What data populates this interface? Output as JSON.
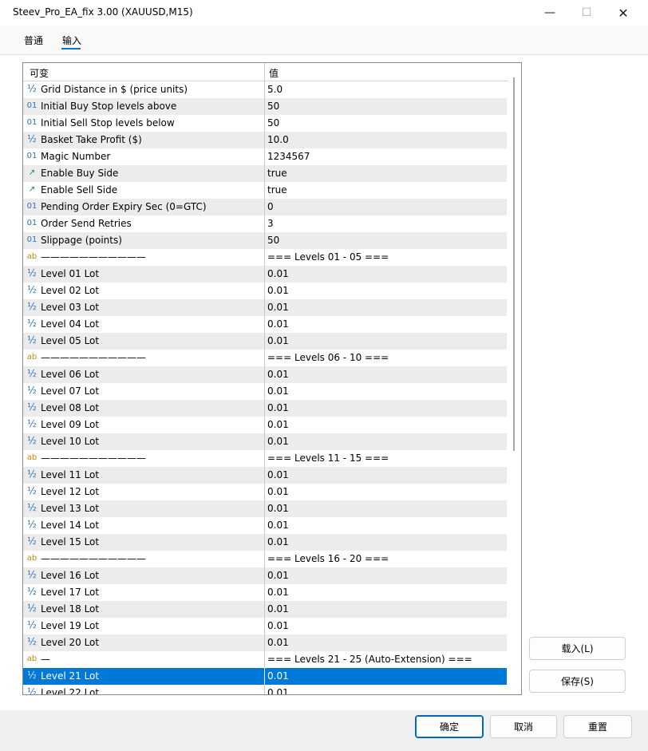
{
  "window": {
    "title": "Steev_Pro_EA_fix 3.00 (XAUUSD,M15)",
    "minimize_glyph": "—",
    "maximize_glyph": "☐",
    "close_glyph": "✕"
  },
  "tabs": [
    {
      "label": "普通"
    },
    {
      "label": "输入"
    }
  ],
  "table": {
    "col_variable": "可变",
    "col_value": "值",
    "rows": [
      {
        "icon": "½",
        "type": "double",
        "name": "Grid Distance in $ (price units)",
        "value": "5.0"
      },
      {
        "icon": "01",
        "type": "int",
        "name": "Initial Buy Stop levels above",
        "value": "50"
      },
      {
        "icon": "01",
        "type": "int",
        "name": "Initial Sell Stop levels below",
        "value": "50"
      },
      {
        "icon": "½",
        "type": "double",
        "name": "Basket Take Profit ($)",
        "value": "10.0"
      },
      {
        "icon": "01",
        "type": "int",
        "name": "Magic Number",
        "value": "1234567"
      },
      {
        "icon": "↗",
        "type": "bool",
        "name": "Enable Buy Side",
        "value": "true"
      },
      {
        "icon": "↗",
        "type": "bool",
        "name": "Enable Sell Side",
        "value": "true"
      },
      {
        "icon": "01",
        "type": "int",
        "name": "Pending Order Expiry Sec (0=GTC)",
        "value": "0"
      },
      {
        "icon": "01",
        "type": "int",
        "name": "Order Send Retries",
        "value": "3"
      },
      {
        "icon": "01",
        "type": "int",
        "name": "Slippage (points)",
        "value": "50"
      },
      {
        "icon": "ab",
        "type": "string",
        "name": "———————————",
        "value": "=== Levels 01 - 05 ==="
      },
      {
        "icon": "½",
        "type": "double",
        "name": "Level 01 Lot",
        "value": "0.01"
      },
      {
        "icon": "½",
        "type": "double",
        "name": "Level 02 Lot",
        "value": "0.01"
      },
      {
        "icon": "½",
        "type": "double",
        "name": "Level 03 Lot",
        "value": "0.01"
      },
      {
        "icon": "½",
        "type": "double",
        "name": "Level 04 Lot",
        "value": "0.01"
      },
      {
        "icon": "½",
        "type": "double",
        "name": "Level 05 Lot",
        "value": "0.01"
      },
      {
        "icon": "ab",
        "type": "string",
        "name": "———————————",
        "value": "=== Levels 06 - 10 ==="
      },
      {
        "icon": "½",
        "type": "double",
        "name": "Level 06 Lot",
        "value": "0.01"
      },
      {
        "icon": "½",
        "type": "double",
        "name": "Level 07 Lot",
        "value": "0.01"
      },
      {
        "icon": "½",
        "type": "double",
        "name": "Level 08 Lot",
        "value": "0.01"
      },
      {
        "icon": "½",
        "type": "double",
        "name": "Level 09 Lot",
        "value": "0.01"
      },
      {
        "icon": "½",
        "type": "double",
        "name": "Level 10 Lot",
        "value": "0.01"
      },
      {
        "icon": "ab",
        "type": "string",
        "name": "———————————",
        "value": "=== Levels 11 - 15 ==="
      },
      {
        "icon": "½",
        "type": "double",
        "name": "Level 11 Lot",
        "value": "0.01"
      },
      {
        "icon": "½",
        "type": "double",
        "name": "Level 12 Lot",
        "value": "0.01"
      },
      {
        "icon": "½",
        "type": "double",
        "name": "Level 13 Lot",
        "value": "0.01"
      },
      {
        "icon": "½",
        "type": "double",
        "name": "Level 14 Lot",
        "value": "0.01"
      },
      {
        "icon": "½",
        "type": "double",
        "name": "Level 15 Lot",
        "value": "0.01"
      },
      {
        "icon": "ab",
        "type": "string",
        "name": "———————————",
        "value": "=== Levels 16 - 20 ==="
      },
      {
        "icon": "½",
        "type": "double",
        "name": "Level 16 Lot",
        "value": "0.01"
      },
      {
        "icon": "½",
        "type": "double",
        "name": "Level 17 Lot",
        "value": "0.01"
      },
      {
        "icon": "½",
        "type": "double",
        "name": "Level 18 Lot",
        "value": "0.01"
      },
      {
        "icon": "½",
        "type": "double",
        "name": "Level 19 Lot",
        "value": "0.01"
      },
      {
        "icon": "½",
        "type": "double",
        "name": "Level 20 Lot",
        "value": "0.01"
      },
      {
        "icon": "ab",
        "type": "string",
        "name": "—",
        "value": "=== Levels 21 - 25 (Auto-Extension) ==="
      },
      {
        "icon": "½",
        "type": "double",
        "name": "Level 21 Lot",
        "value": "0.01",
        "selected": true
      },
      {
        "icon": "½",
        "type": "double",
        "name": "Level 22 Lot",
        "value": "0.01"
      }
    ]
  },
  "side_buttons": {
    "load": "载入(L)",
    "save": "保存(S)"
  },
  "footer": {
    "ok": "确定",
    "cancel": "取消",
    "reset": "重置"
  }
}
